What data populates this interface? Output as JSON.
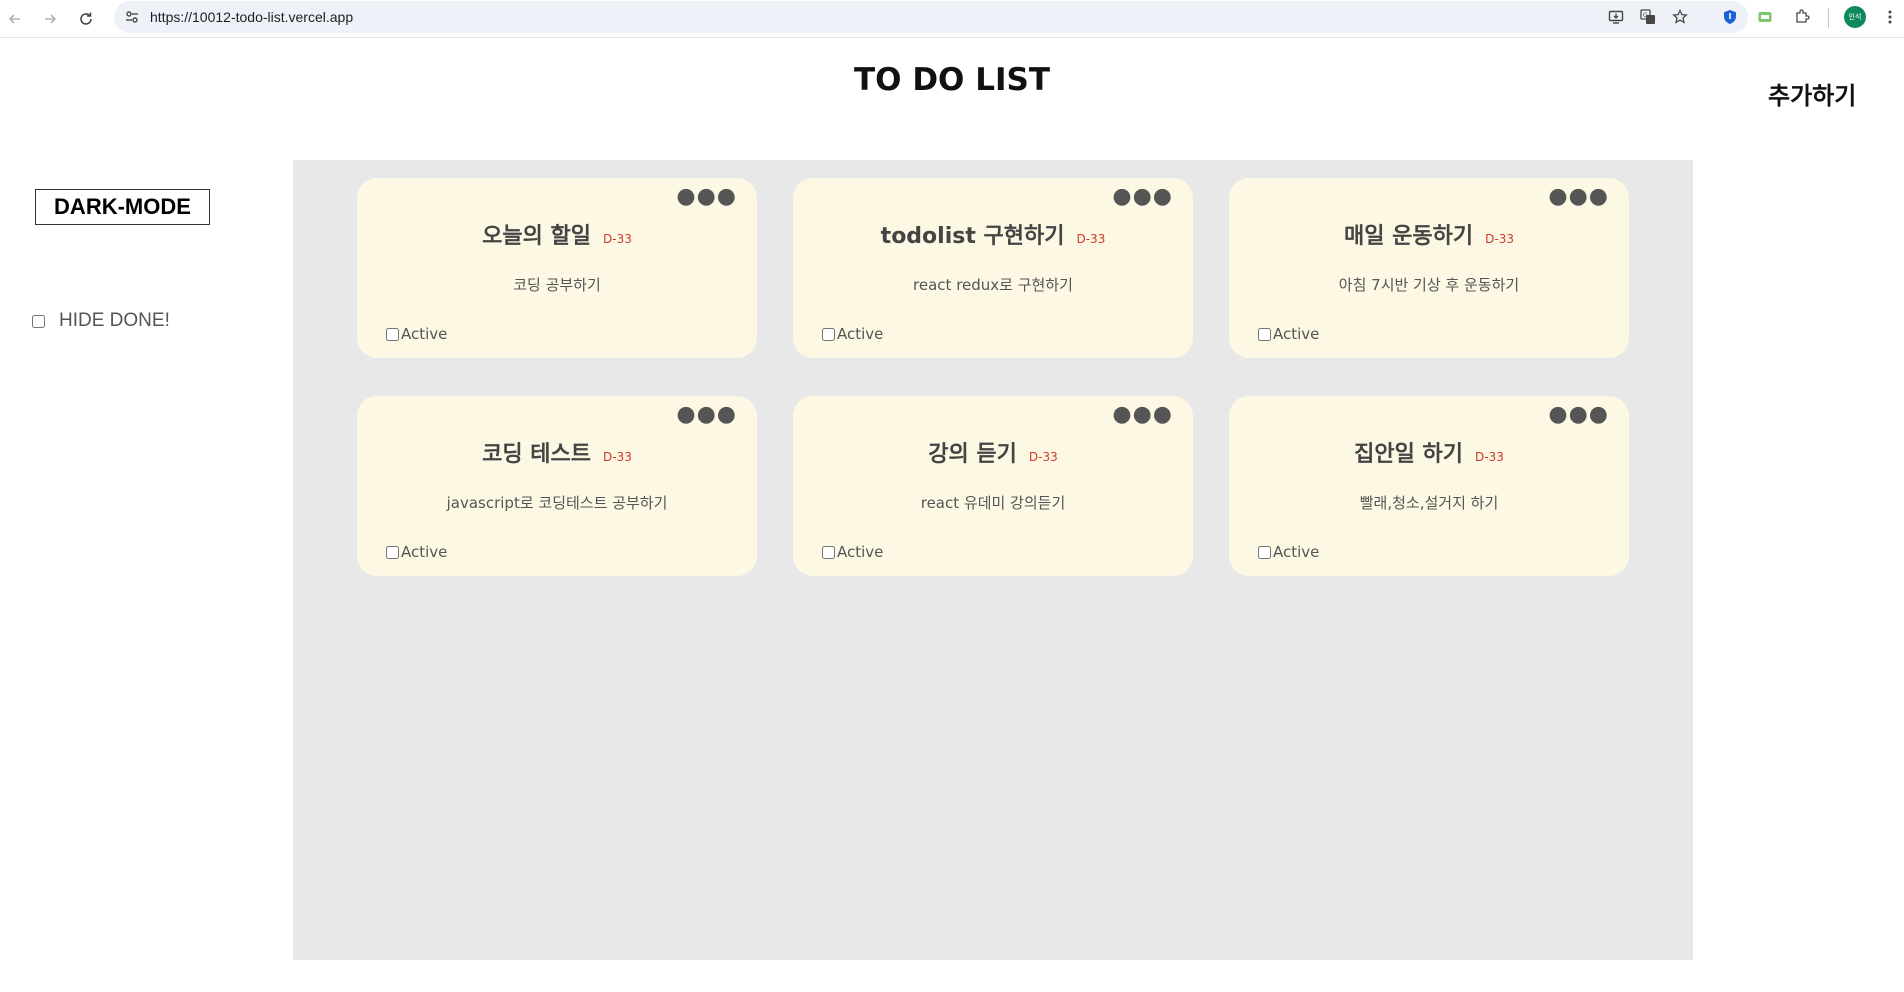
{
  "browser": {
    "url": "https://10012-todo-list.vercel.app",
    "profile_label": "인석"
  },
  "header": {
    "title": "TO DO LIST",
    "add_label": "추가하기"
  },
  "sidebar": {
    "dark_mode_label": "DARK-MODE",
    "hide_done_label": "HIDE DONE!",
    "hide_done_checked": false
  },
  "todos": [
    {
      "title": "오늘의 할일",
      "dday": "D-33",
      "description": "코딩 공부하기",
      "status_label": "Active",
      "done": false
    },
    {
      "title": "todolist 구현하기",
      "dday": "D-33",
      "description": "react redux로 구현하기",
      "status_label": "Active",
      "done": false
    },
    {
      "title": "매일 운동하기",
      "dday": "D-33",
      "description": "아침 7시반 기상 후 운동하기",
      "status_label": "Active",
      "done": false
    },
    {
      "title": "코딩 테스트",
      "dday": "D-33",
      "description": "javascript로 코딩테스트 공부하기",
      "status_label": "Active",
      "done": false
    },
    {
      "title": "강의 듣기",
      "dday": "D-33",
      "description": "react 유데미 강의듣기",
      "status_label": "Active",
      "done": false
    },
    {
      "title": "집안일 하기",
      "dday": "D-33",
      "description": "빨래,청소,설거지 하기",
      "status_label": "Active",
      "done": false
    }
  ],
  "colors": {
    "board_bg": "#e8e8e8",
    "card_bg": "#fdf8e4",
    "dday": "#d03a2c"
  }
}
